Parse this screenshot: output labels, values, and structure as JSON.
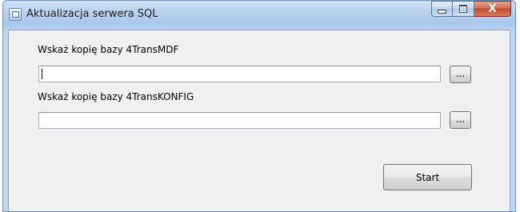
{
  "window": {
    "title": "Aktualizacja serwera SQL"
  },
  "titlebar_buttons": {
    "minimize": "minimize",
    "maximize": "maximize",
    "close": "X"
  },
  "form": {
    "mdf_label": "Wskaż kopię bazy 4TransMDF",
    "mdf_value": "",
    "konfig_label": "Wskaż kopię bazy 4TransKONFIG",
    "konfig_value": "",
    "browse_label": "...",
    "start_label": "Start"
  }
}
